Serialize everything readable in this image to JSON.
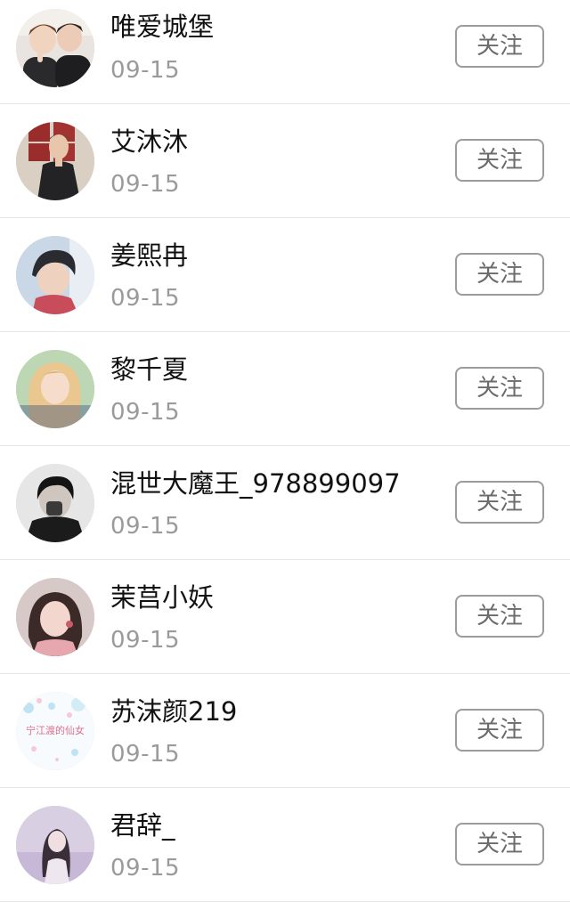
{
  "follow_label": "关注",
  "items": [
    {
      "name": "唯爱城堡",
      "date": "09-15",
      "avatar": "avatar-two-boys"
    },
    {
      "name": "艾沐沐",
      "date": "09-15",
      "avatar": "avatar-boy-black-jacket"
    },
    {
      "name": "姜熙冉",
      "date": "09-15",
      "avatar": "avatar-boy-soft-hair"
    },
    {
      "name": "黎千夏",
      "date": "09-15",
      "avatar": "avatar-blonde-girl"
    },
    {
      "name": "混世大魔王_978899097",
      "date": "09-15",
      "avatar": "avatar-dark-hooded"
    },
    {
      "name": "茉莒小妖",
      "date": "09-15",
      "avatar": "avatar-girl-pink"
    },
    {
      "name": "苏沫颜219",
      "date": "09-15",
      "avatar": "avatar-fairy-text",
      "avatar_text": "宁江渡的仙女"
    },
    {
      "name": "君辞_",
      "date": "09-15",
      "avatar": "avatar-girl-violet"
    }
  ],
  "colors": {
    "name_text": "#111111",
    "date_text": "#9a9a9a",
    "button_border": "#9c9c9c",
    "button_text": "#6b6b6b",
    "divider": "#e6e6e6"
  }
}
